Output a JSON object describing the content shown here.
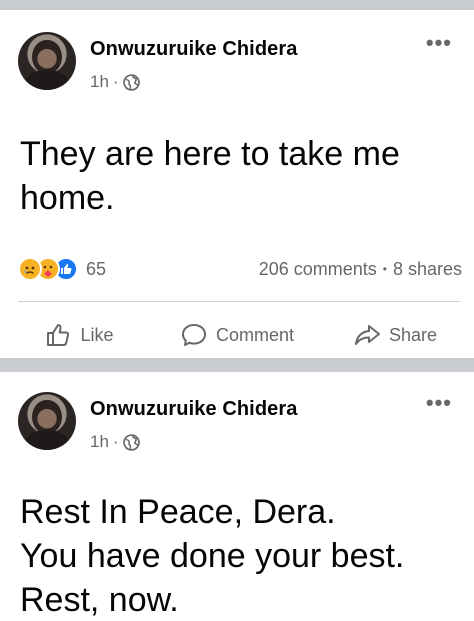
{
  "posts": [
    {
      "author": "Onwuzuruike Chidera",
      "time": "1h",
      "audience_icon": "globe-icon",
      "text_lines": [
        "They are here to take me",
        "home."
      ],
      "reactions": [
        "sad-reaction-icon",
        "care-reaction-icon",
        "like-reaction-icon"
      ],
      "reaction_count": "65",
      "comments": "206 comments",
      "shares": "8 shares",
      "actions": {
        "like": "Like",
        "comment": "Comment",
        "share": "Share"
      }
    },
    {
      "author": "Onwuzuruike Chidera",
      "time": "1h",
      "audience_icon": "globe-icon",
      "text_lines": [
        "Rest In Peace, Dera.",
        "You have done your best.",
        "Rest, now."
      ]
    }
  ],
  "colors": {
    "text": "#050505",
    "muted": "#65676b",
    "divider": "#c9ccd1",
    "like_blue": "#1877f2",
    "reaction_yellow": "#f7b125"
  }
}
